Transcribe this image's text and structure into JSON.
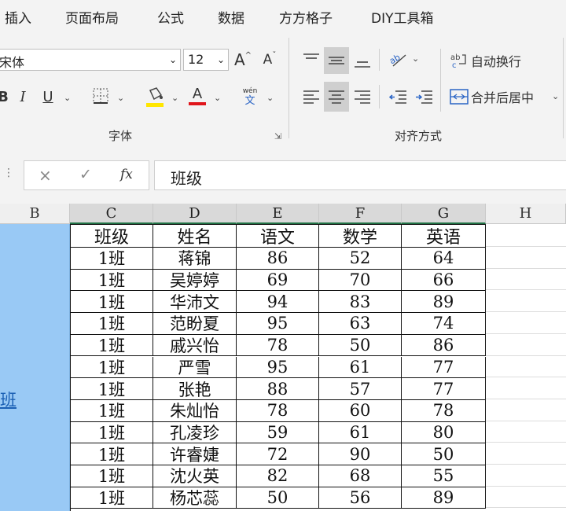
{
  "menu": {
    "tabs": [
      "插入",
      "页面布局",
      "公式",
      "数据",
      "方方格子",
      "DIY工具箱"
    ]
  },
  "ribbon": {
    "font_name": "宋体",
    "font_size": "12",
    "grow_font": "A",
    "shrink_font": "A",
    "bold": "B",
    "italic": "I",
    "underline": "U",
    "font_color_glyph": "A",
    "phonetic_top": "wén",
    "phonetic_bottom": "文",
    "wrap_text": "自动换行",
    "merge_center": "合并后居中",
    "font_group_label": "字体",
    "align_group_label": "对齐方式"
  },
  "formula": {
    "cancel": "×",
    "enter": "✓",
    "fx": "fx",
    "content": "班级"
  },
  "grid": {
    "columns": [
      "B",
      "C",
      "D",
      "E",
      "F",
      "G",
      "H"
    ],
    "merged_b_text": "班",
    "header_row": [
      "班级",
      "姓名",
      "语文",
      "数学",
      "英语"
    ],
    "rows": [
      [
        "1班",
        "蒋锦",
        "86",
        "52",
        "64"
      ],
      [
        "1班",
        "吴婷婷",
        "69",
        "70",
        "66"
      ],
      [
        "1班",
        "华沛文",
        "94",
        "83",
        "89"
      ],
      [
        "1班",
        "范盼夏",
        "95",
        "63",
        "74"
      ],
      [
        "1班",
        "戚兴怡",
        "78",
        "50",
        "86"
      ],
      [
        "1班",
        "严雪",
        "95",
        "61",
        "77"
      ],
      [
        "1班",
        "张艳",
        "88",
        "57",
        "77"
      ],
      [
        "1班",
        "朱灿怡",
        "78",
        "60",
        "78"
      ],
      [
        "1班",
        "孔凌珍",
        "59",
        "61",
        "80"
      ],
      [
        "1班",
        "许睿婕",
        "72",
        "90",
        "50"
      ],
      [
        "1班",
        "沈火英",
        "82",
        "68",
        "55"
      ],
      [
        "1班",
        "杨芯蕊",
        "50",
        "56",
        "89"
      ]
    ]
  },
  "colors": {
    "selection_blue": "#99c9f5",
    "selected_col_border": "#217346",
    "font_fill_yellow": "#ffe600",
    "font_color_red": "#e0151b",
    "link_blue": "#1a5fb4"
  }
}
